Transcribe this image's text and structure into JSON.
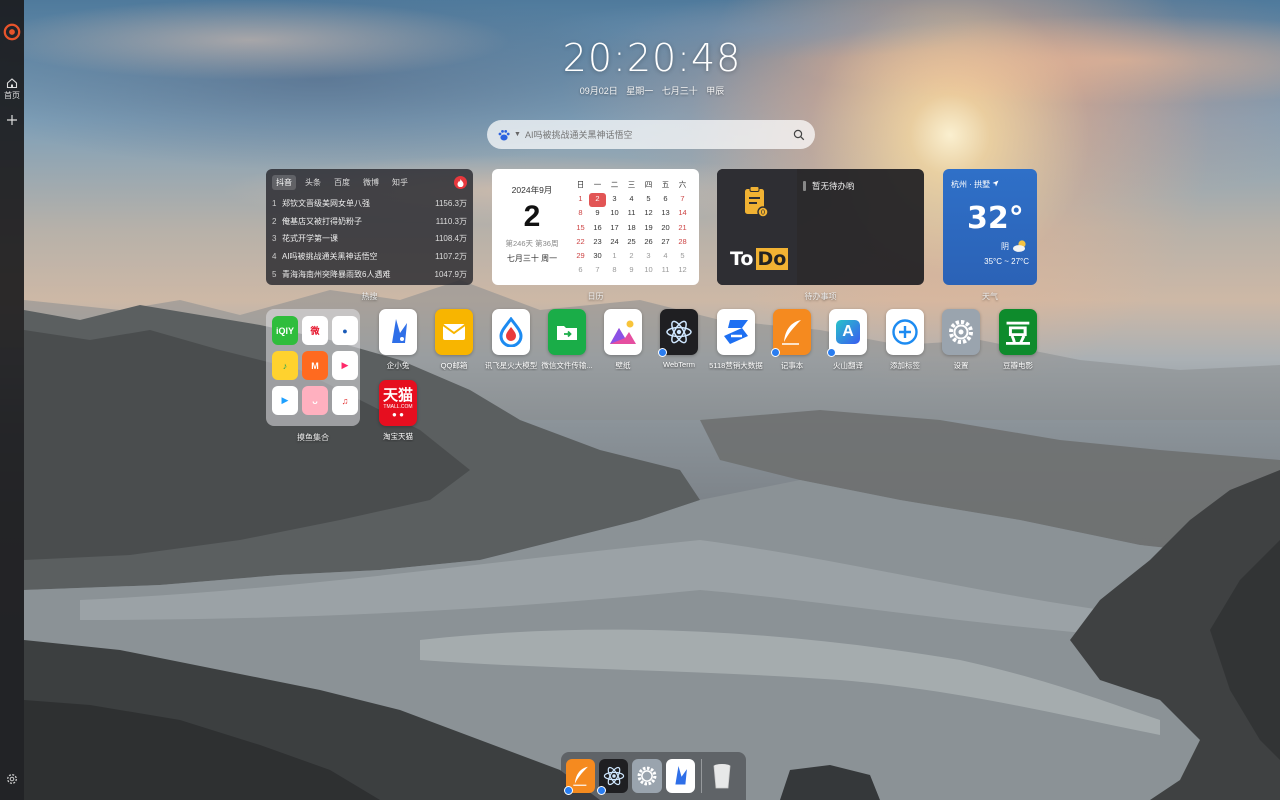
{
  "clock": {
    "time": "20:20:48",
    "date": "09月02日",
    "weekday": "星期一",
    "lunar": "七月三十",
    "ganzhi": "甲辰"
  },
  "search": {
    "placeholder": "AI吗被挑战通关黑神话悟空"
  },
  "sidebar": {
    "home_label": "首页"
  },
  "hot": {
    "tabs": [
      "抖音",
      "头条",
      "百度",
      "微博",
      "知乎"
    ],
    "items": [
      {
        "rank": "1",
        "title": "郑钦文晋级美网女单八强",
        "count": "1156.3万"
      },
      {
        "rank": "2",
        "title": "俺基店又被打得奶粉子",
        "count": "1110.3万"
      },
      {
        "rank": "3",
        "title": "花式开学第一课",
        "count": "1108.4万"
      },
      {
        "rank": "4",
        "title": "AI吗被挑战通关黑神话悟空",
        "count": "1107.2万"
      },
      {
        "rank": "5",
        "title": "青海海南州突降暴雨致6人遇难",
        "count": "1047.9万"
      }
    ],
    "caption": "热搜"
  },
  "calendar": {
    "month": "2024年9月",
    "day": "2",
    "info": "第246天 第36周",
    "lunar": "七月三十 周一",
    "caption": "日历",
    "weekdays": [
      "日",
      "一",
      "二",
      "三",
      "四",
      "五",
      "六"
    ],
    "weeks": [
      [
        "1",
        "2",
        "3",
        "4",
        "5",
        "6",
        "7"
      ],
      [
        "8",
        "9",
        "10",
        "11",
        "12",
        "13",
        "14"
      ],
      [
        "15",
        "16",
        "17",
        "18",
        "19",
        "20",
        "21"
      ],
      [
        "22",
        "23",
        "24",
        "25",
        "26",
        "27",
        "28"
      ],
      [
        "29",
        "30",
        "1",
        "2",
        "3",
        "4",
        "5"
      ],
      [
        "6",
        "7",
        "8",
        "9",
        "10",
        "11",
        "12"
      ]
    ]
  },
  "todo": {
    "empty_text": "暂无待办哟",
    "logo_to": "To",
    "logo_do": "Do",
    "caption": "待办事项",
    "badge": "0"
  },
  "weather": {
    "location": "杭州 · 拱墅",
    "temp": "32°",
    "condition": "阴",
    "range": "35°C ~ 27°C",
    "caption": "天气"
  },
  "folder": {
    "label": "摸鱼集合",
    "items": [
      {
        "name": "iqiyi-icon",
        "text": "iQIY",
        "bg": "#2fbd3c",
        "fg": "#ffffff"
      },
      {
        "name": "weibo-icon",
        "text": "微",
        "bg": "#ffffff",
        "fg": "#e6162d"
      },
      {
        "name": "tencent-video-blue-icon",
        "text": "●",
        "bg": "#ffffff",
        "fg": "#1a5bb8"
      },
      {
        "name": "qq-music-icon",
        "text": "♪",
        "bg": "#ffd22e",
        "fg": "#1aa35b"
      },
      {
        "name": "mango-tv-icon",
        "text": "M",
        "bg": "#ff6a1f",
        "fg": "#ffffff"
      },
      {
        "name": "youku-icon",
        "text": "▶",
        "bg": "#ffffff",
        "fg": "#ff2a6a"
      },
      {
        "name": "tencent-video-icon",
        "text": "▶",
        "bg": "#ffffff",
        "fg": "#1ea0ff"
      },
      {
        "name": "bilibili-icon",
        "text": "ᴗ",
        "bg": "#ffb0bf",
        "fg": "#ffffff"
      },
      {
        "name": "douyin-netease-icon",
        "text": "♫",
        "bg": "#ffffff",
        "fg": "#e22c2c"
      }
    ]
  },
  "apps": [
    {
      "name": "企小兔",
      "id": "qixiaotu"
    },
    {
      "name": "QQ邮箱",
      "id": "qq-mail"
    },
    {
      "name": "讯飞星火大模型",
      "id": "xunfei-spark"
    },
    {
      "name": "微信文件传输...",
      "id": "wechat-file-transfer"
    },
    {
      "name": "壁纸",
      "id": "wallpaper"
    },
    {
      "name": "WebTerm",
      "id": "webterm"
    },
    {
      "name": "5118营销大数据",
      "id": "5118-marketing"
    },
    {
      "name": "记事本",
      "id": "notepad"
    },
    {
      "name": "火山翻译",
      "id": "volcano-translate"
    },
    {
      "name": "添加标签",
      "id": "add-tag"
    },
    {
      "name": "设置",
      "id": "settings"
    },
    {
      "name": "豆瓣电影",
      "id": "douban-movie"
    },
    {
      "name": "淘宝天猫",
      "id": "taobao-tmall"
    }
  ],
  "app_text": {
    "douban": "豆",
    "tmall_main": "天猫",
    "tmall_sub": "TMALL.COM",
    "volcano": "A"
  },
  "colors": {
    "accent_red": "#e25555",
    "weather_blue": "#2f70c8",
    "todo_yellow": "#f1b233"
  }
}
